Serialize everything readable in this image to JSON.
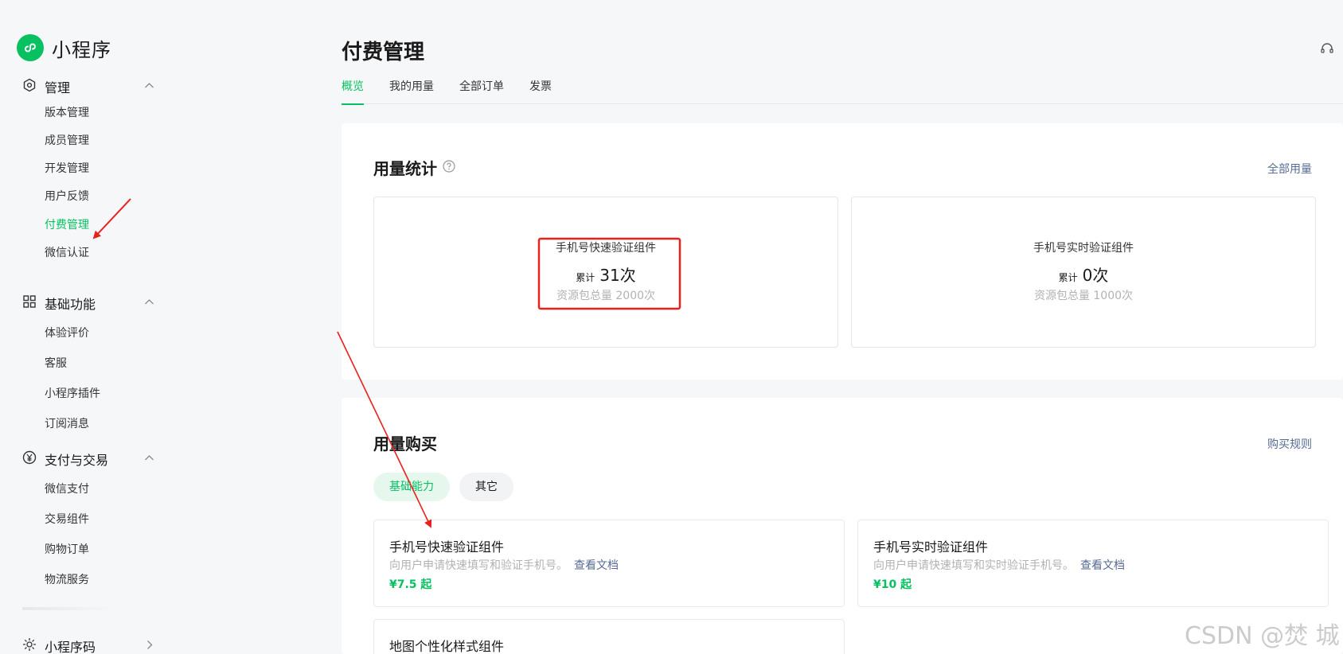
{
  "sidebar": {
    "brand": "小程序",
    "groups": [
      {
        "label": "管理",
        "items": [
          "版本管理",
          "成员管理",
          "开发管理",
          "用户反馈",
          "付费管理",
          "微信认证"
        ]
      },
      {
        "label": "基础功能",
        "items": [
          "体验评价",
          "客服",
          "小程序插件",
          "订阅消息"
        ]
      },
      {
        "label": "支付与交易",
        "items": [
          "微信支付",
          "交易组件",
          "购物订单",
          "物流服务"
        ]
      },
      {
        "label": "小程序码"
      }
    ],
    "active_item": "付费管理"
  },
  "main": {
    "title": "付费管理",
    "tabs": [
      "概览",
      "我的用量",
      "全部订单",
      "发票"
    ],
    "active_tab": "概览",
    "usage": {
      "title": "用量统计",
      "link": "全部用量",
      "cards": [
        {
          "name": "手机号快速验证组件",
          "total_label": "累计",
          "total_value": "31次",
          "quota": "资源包总量 2000次"
        },
        {
          "name": "手机号实时验证组件",
          "total_label": "累计",
          "total_value": "0次",
          "quota": "资源包总量 1000次"
        }
      ]
    },
    "purchase": {
      "title": "用量购买",
      "link": "购买规则",
      "chips": [
        "基础能力",
        "其它"
      ],
      "active_chip": "基础能力",
      "products": [
        {
          "name": "手机号快速验证组件",
          "desc": "向用户申请快速填写和验证手机号。",
          "doc": "查看文档",
          "price": "¥7.5 起"
        },
        {
          "name": "手机号实时验证组件",
          "desc": "向用户申请快速填写和实时验证手机号。",
          "doc": "查看文档",
          "price": "¥10 起"
        },
        {
          "name": "地图个性化样式组件"
        }
      ]
    }
  },
  "watermark": "CSDN @焚 城",
  "colors": {
    "accent": "#07c160",
    "link": "#576b95",
    "annotation": "#e8211d"
  }
}
